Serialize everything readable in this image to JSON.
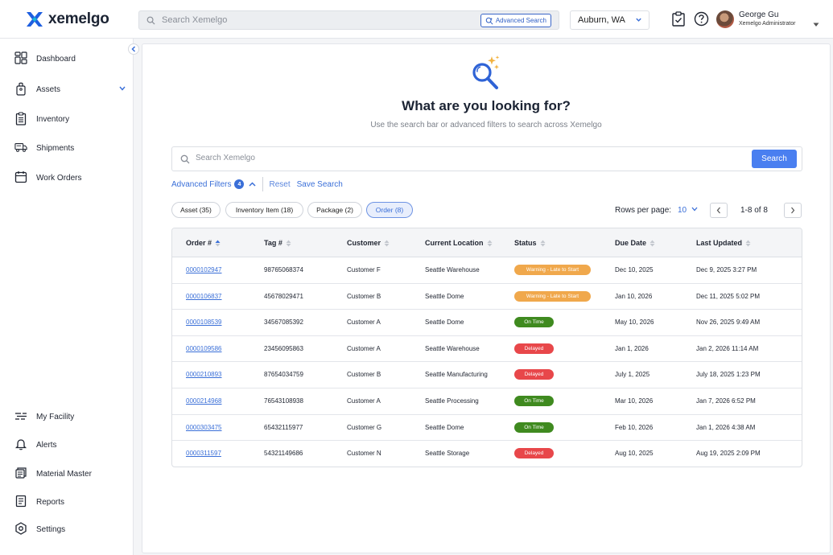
{
  "brand": {
    "name": "xemelgo"
  },
  "header": {
    "search_placeholder": "Search Xemelgo",
    "advanced_search_label": "Advanced Search",
    "location": "Auburn, WA",
    "user_name": "George Gu",
    "user_role": "Xemelgo Administrator"
  },
  "sidebar": {
    "items": [
      {
        "label": "Dashboard",
        "icon": "dashboard-icon"
      },
      {
        "label": "Assets",
        "icon": "asset-tag-icon"
      },
      {
        "label": "Inventory",
        "icon": "clipboard-list-icon"
      },
      {
        "label": "Shipments",
        "icon": "truck-icon"
      },
      {
        "label": "Work Orders",
        "icon": "calendar-icon"
      }
    ],
    "bottom_items": [
      {
        "label": "My Facility",
        "icon": "facility-icon"
      },
      {
        "label": "Alerts",
        "icon": "bell-icon"
      },
      {
        "label": "Material Master",
        "icon": "material-icon"
      },
      {
        "label": "Reports",
        "icon": "report-icon"
      },
      {
        "label": "Settings",
        "icon": "settings-icon"
      }
    ]
  },
  "hero": {
    "title": "What are you looking for?",
    "subtitle": "Use the search bar or advanced filters to search across Xemelgo"
  },
  "search": {
    "placeholder": "Search Xemelgo",
    "button_label": "Search"
  },
  "filters": {
    "advanced_label": "Advanced Filters",
    "advanced_count": "4",
    "reset_label": "Reset",
    "save_label": "Save Search"
  },
  "chips": [
    {
      "label": "Asset (35)",
      "active": false
    },
    {
      "label": "Inventory Item (18)",
      "active": false
    },
    {
      "label": "Package (2)",
      "active": false
    },
    {
      "label": "Order (8)",
      "active": true
    }
  ],
  "pagination": {
    "rows_per_page_label": "Rows per page:",
    "rows_per_page": "10",
    "range": "1-8 of 8"
  },
  "table": {
    "columns": [
      "Order #",
      "Tag #",
      "Customer",
      "Current Location",
      "Status",
      "Due Date",
      "Last Updated"
    ],
    "rows": [
      {
        "order": "0000102947",
        "tag": "98765068374",
        "customer": "Customer F",
        "location": "Seattle Warehouse",
        "status": "Warning - Late to Start",
        "status_type": "warning",
        "due": "Dec 10, 2025",
        "updated": "Dec 9, 2025  3:27 PM"
      },
      {
        "order": "0000106837",
        "tag": "45678029471",
        "customer": "Customer B",
        "location": "Seattle Dome",
        "status": "Warning - Late to Start",
        "status_type": "warning",
        "due": "Jan 10, 2026",
        "updated": "Dec 11, 2025  5:02 PM"
      },
      {
        "order": "0000108539",
        "tag": "34567085392",
        "customer": "Customer A",
        "location": "Seattle Dome",
        "status": "On Time",
        "status_type": "ontime",
        "due": "May 10, 2026",
        "updated": "Nov 26, 2025  9:49 AM"
      },
      {
        "order": "0000109586",
        "tag": "23456095863",
        "customer": "Customer A",
        "location": "Seattle Warehouse",
        "status": "Delayed",
        "status_type": "delayed",
        "due": "Jan 1, 2026",
        "updated": "Jan 2, 2026 11:14 AM"
      },
      {
        "order": "0000210893",
        "tag": "87654034759",
        "customer": "Customer B",
        "location": "Seattle Manufacturing",
        "status": "Delayed",
        "status_type": "delayed",
        "due": "July 1, 2025",
        "updated": "July 18, 2025 1:23 PM"
      },
      {
        "order": "0000214968",
        "tag": "76543108938",
        "customer": "Customer A",
        "location": "Seattle Processing",
        "status": "On Time",
        "status_type": "ontime",
        "due": "Mar 10, 2026",
        "updated": "Jan 7, 2026 6:52 PM"
      },
      {
        "order": "0000303475",
        "tag": "65432115977",
        "customer": "Customer G",
        "location": "Seattle Dome",
        "status": "On Time",
        "status_type": "ontime",
        "due": "Feb 10, 2026",
        "updated": "Jan 1, 2026 4:38 AM"
      },
      {
        "order": "0000311597",
        "tag": "54321149686",
        "customer": "Customer N",
        "location": "Seattle Storage",
        "status": "Delayed",
        "status_type": "delayed",
        "due": "Aug 10, 2025",
        "updated": "Aug 19, 2025 2:09 PM"
      }
    ]
  },
  "colors": {
    "primary": "#3a6fd8",
    "button": "#4a7ff0",
    "warning": "#f0a84c",
    "ontime": "#3f8a1f",
    "delayed": "#e8474a"
  }
}
